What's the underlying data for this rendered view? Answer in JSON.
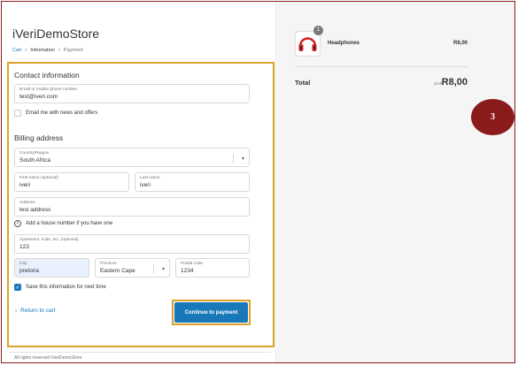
{
  "store": {
    "name": "iVeriDemoStore"
  },
  "breadcrumb": {
    "cart": "Cart",
    "information": "Information",
    "payment": "Payment",
    "sep": "›"
  },
  "contact": {
    "title": "Contact information",
    "email_label": "Email or mobile phone number",
    "email_value": "test@iveri.com",
    "news_label": "Email me with news and offers"
  },
  "billing": {
    "title": "Billing address",
    "country_label": "Country/Region",
    "country_value": "South Africa",
    "first_label": "First name (optional)",
    "first_value": "iveri",
    "last_label": "Last name",
    "last_value": "iveri",
    "address_label": "Address",
    "address_value": "test address",
    "house_hint": "Add a house number if you have one",
    "apt_label": "Apartment, suite, etc. (optional)",
    "apt_value": "123",
    "city_label": "City",
    "city_value": "pretoria",
    "province_label": "Province",
    "province_value": "Eastern Cape",
    "postal_label": "Postal code",
    "postal_value": "1234",
    "save_label": "Save this information for next time"
  },
  "actions": {
    "return_label": "Return to cart",
    "return_chevron": "‹",
    "continue_label": "Continue to payment"
  },
  "footer": {
    "text": "All rights reserved iVeriDemoStore"
  },
  "summary": {
    "product_name": "Headphones",
    "product_price": "R8,00",
    "quantity": "1",
    "total_label": "Total",
    "currency": "ZAR",
    "total_value": "R8,00"
  },
  "annotation": {
    "step": "3"
  },
  "icons": {
    "info": "info-icon",
    "select": "chevron-down-icon",
    "check": "checkmark-icon",
    "product": "headphones-icon"
  },
  "colors": {
    "accent": "#1878b9",
    "highlight": "#d8a329",
    "badge": "#8b1a1a"
  }
}
